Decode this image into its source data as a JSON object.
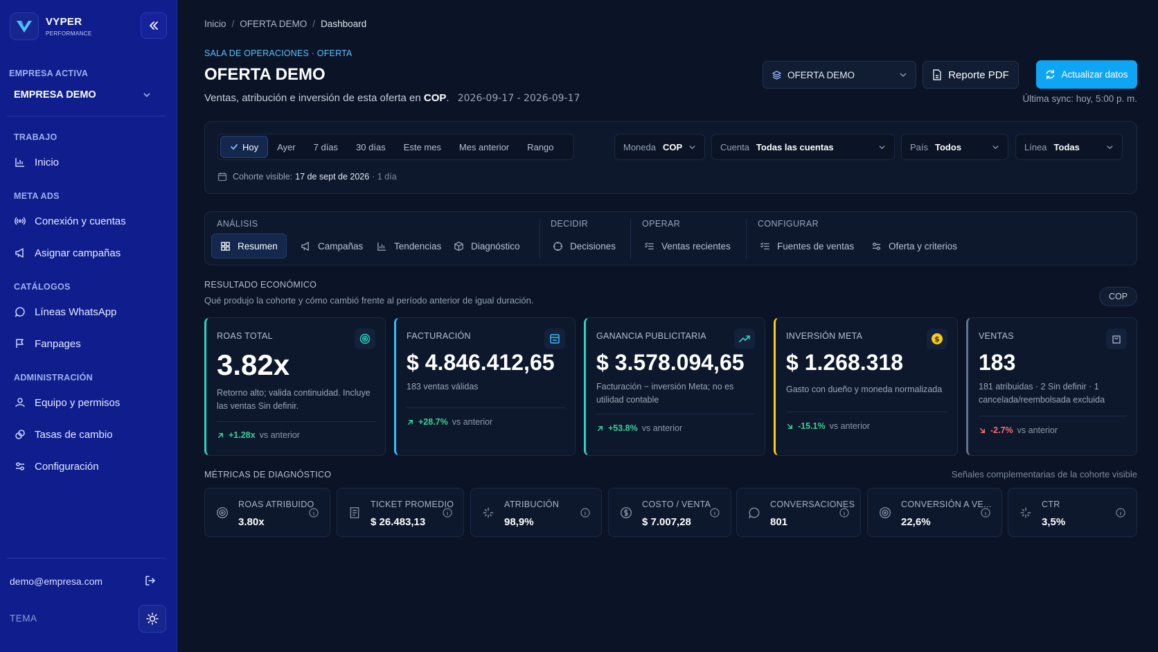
{
  "brand": {
    "name": "VYPER",
    "sub": "PERFORMANCE"
  },
  "sidebar": {
    "company_label": "EMPRESA ACTIVA",
    "company_value": "EMPRESA DEMO",
    "sections": {
      "trabajo": "TRABAJO",
      "meta": "META ADS",
      "catalogos": "CATÁLOGOS",
      "admin": "ADMINISTRACIÓN"
    },
    "items": {
      "inicio": "Inicio",
      "conexion": "Conexión y cuentas",
      "asignar": "Asignar campañas",
      "lineas": "Líneas WhatsApp",
      "fanpages": "Fanpages",
      "equipo": "Equipo y permisos",
      "tasas": "Tasas de cambio",
      "config": "Configuración"
    },
    "user_email": "demo@empresa.com",
    "theme_label": "TEMA"
  },
  "header": {
    "breadcrumb": [
      "Inicio",
      "OFERTA DEMO",
      "Dashboard"
    ],
    "eyebrow": "SALA DE OPERACIONES · OFERTA",
    "title": "OFERTA DEMO",
    "subtitle_pre": "Ventas, atribución e inversión de esta oferta en",
    "subtitle_currency": "COP",
    "subtitle_dates": "2026-09-17 - 2026-09-17",
    "offer_select": "OFERTA DEMO",
    "pdf_label": "Reporte PDF",
    "update_label": "Actualizar datos",
    "sync": "Última sync: hoy, 5:00 p. m."
  },
  "filters": {
    "ranges": [
      "Hoy",
      "Ayer",
      "7 días",
      "30 días",
      "Este mes",
      "Mes anterior",
      "Rango"
    ],
    "moneda": {
      "label": "Moneda",
      "value": "COP"
    },
    "cuenta": {
      "label": "Cuenta",
      "value": "Todas las cuentas"
    },
    "pais": {
      "label": "País",
      "value": "Todos"
    },
    "linea": {
      "label": "Línea",
      "value": "Todas"
    },
    "cohort_label": "Cohorte visible:",
    "cohort_date": "17 de sept de 2026",
    "cohort_span": "· 1 día"
  },
  "tabs": {
    "groups": {
      "analisis": "ANÁLISIS",
      "decidir": "DECIDIR",
      "operar": "OPERAR",
      "configurar": "CONFIGURAR"
    },
    "items": {
      "resumen": "Resumen",
      "campanas": "Campañas",
      "tendencias": "Tendencias",
      "diagnostico": "Diagnóstico",
      "decisiones": "Decisiones",
      "ventas": "Ventas recientes",
      "fuentes": "Fuentes de ventas",
      "oferta": "Oferta y criterios"
    }
  },
  "economic": {
    "title": "RESULTADO ECONÓMICO",
    "desc": "Qué produjo la cohorte y cómo cambió frente al período anterior de igual duración.",
    "currency_pill": "COP",
    "vs": "vs anterior",
    "cards": [
      {
        "label": "ROAS TOTAL",
        "value": "3.82x",
        "desc": "Retorno alto; valida continuidad. Incluye las ventas Sin definir.",
        "delta": "+1.28x",
        "color": "#2dd4bf"
      },
      {
        "label": "FACTURACIÓN",
        "value": "$ 4.846.412,65",
        "desc": "183 ventas válidas",
        "delta": "+28.7%",
        "color": "#38bdf8"
      },
      {
        "label": "GANANCIA PUBLICITARIA",
        "value": "$ 3.578.094,65",
        "desc": "Facturación − inversión Meta; no es utilidad contable",
        "delta": "+53.8%",
        "color": "#2dd4bf"
      },
      {
        "label": "INVERSIÓN META",
        "value": "$ 1.268.318",
        "desc": "Gasto con dueño y moneda normalizada",
        "delta": "-15.1%",
        "color": "#facc15"
      },
      {
        "label": "VENTAS",
        "value": "183",
        "desc": "181 atribuidas · 2 Sin definir · 1 cancelada/reembolsada excluida",
        "delta": "-2.7%",
        "color": "#64748b"
      }
    ]
  },
  "diagnostics": {
    "title": "MÉTRICAS DE DIAGNÓSTICO",
    "subtitle": "Señales complementarias de la cohorte visible",
    "metrics": [
      {
        "label": "ROAS ATRIBUIDO",
        "value": "3.80x"
      },
      {
        "label": "TICKET PROMEDIO",
        "value": "$ 26.483,13"
      },
      {
        "label": "ATRIBUCIÓN",
        "value": "98,9%"
      },
      {
        "label": "COSTO / VENTA",
        "value": "$ 7.007,28"
      },
      {
        "label": "CONVERSACIONES",
        "value": "801"
      },
      {
        "label": "CONVERSIÓN A VE...",
        "value": "22,6%"
      },
      {
        "label": "CTR",
        "value": "3,5%"
      }
    ]
  },
  "colors": {
    "accent": "#0ea5f4",
    "sidebar": "#0f1e8c",
    "background": "#0b1426",
    "up": "#34d399",
    "down": "#f87171"
  }
}
